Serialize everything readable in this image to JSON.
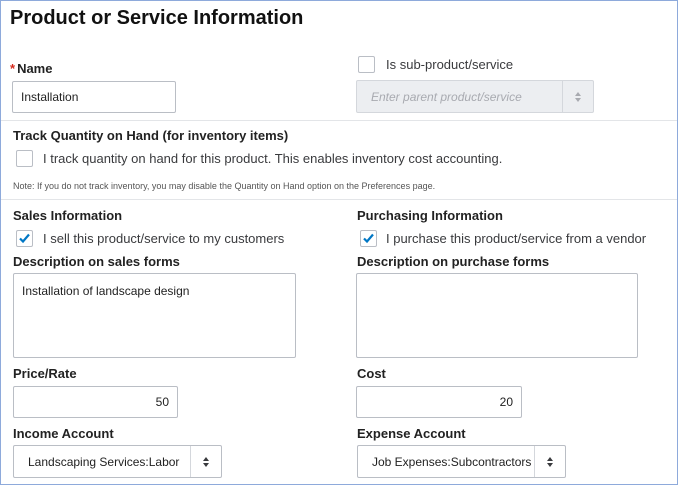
{
  "title": "Product or Service Information",
  "name_field": {
    "label": "Name",
    "required_mark": "*",
    "value": "Installation"
  },
  "sub_product": {
    "label": "Is sub-product/service",
    "checked": false,
    "parent_placeholder": "Enter parent product/service"
  },
  "inventory": {
    "heading": "Track Quantity on Hand (for inventory items)",
    "checkbox_label": "I track quantity on hand for this product. This enables inventory cost accounting.",
    "checked": false,
    "note": "Note: If you do not track inventory, you may disable the Quantity on Hand option on the Preferences page."
  },
  "sales": {
    "heading": "Sales Information",
    "checkbox_label": "I sell this product/service to my customers",
    "checked": true,
    "description_label": "Description on sales forms",
    "description_value": "Installation of landscape design",
    "price_label": "Price/Rate",
    "price_value": "50",
    "account_label": "Income Account",
    "account_value": "Landscaping Services:Labor"
  },
  "purchasing": {
    "heading": "Purchasing Information",
    "checkbox_label": "I purchase this product/service from a vendor",
    "checked": true,
    "description_label": "Description on purchase forms",
    "description_value": "",
    "cost_label": "Cost",
    "cost_value": "20",
    "account_label": "Expense Account",
    "account_value": "Job Expenses:Subcontractors"
  },
  "icons": {
    "checkmark": "checkmark-icon",
    "select_arrows": "select-arrows-icon"
  },
  "colors": {
    "accent": "#0077c5",
    "required": "#d52b1e",
    "border": "#babec5"
  }
}
